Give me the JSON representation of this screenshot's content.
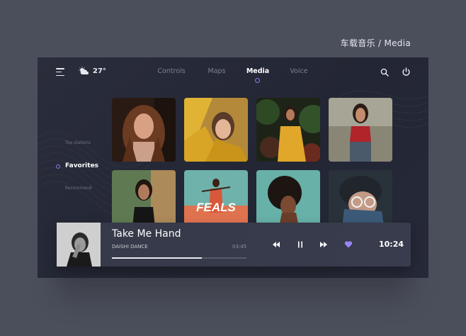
{
  "page_caption": "车载音乐 / Media",
  "header": {
    "weather": {
      "icon": "partly-cloudy-icon",
      "temperature": "27°"
    },
    "tabs": [
      {
        "label": "Controls",
        "active": false
      },
      {
        "label": "Maps",
        "active": false
      },
      {
        "label": "Media",
        "active": true
      },
      {
        "label": "Voice",
        "active": false
      }
    ],
    "icons": [
      "menu-icon",
      "search-icon",
      "power-icon"
    ]
  },
  "sidebar": {
    "items": [
      {
        "label": "Top stations",
        "active": false
      },
      {
        "label": "Favorites",
        "active": true
      },
      {
        "label": "Recommend",
        "active": false
      }
    ]
  },
  "grid": {
    "tiles": [
      {
        "name": "album-woman-brown-hair"
      },
      {
        "name": "album-woman-yellow-top"
      },
      {
        "name": "album-woman-yellow-shirt"
      },
      {
        "name": "album-woman-red-top"
      },
      {
        "name": "album-woman-black-top"
      },
      {
        "name": "album-feals",
        "text": "FEALS"
      },
      {
        "name": "album-woman-afro"
      },
      {
        "name": "album-man-glasses"
      }
    ]
  },
  "player": {
    "title": "Take Me Hand",
    "artist": "DAISHI DANCE",
    "duration": "03:45",
    "progress_fraction": 0.67,
    "time": "10:24",
    "accent": "#8b7cf6"
  }
}
